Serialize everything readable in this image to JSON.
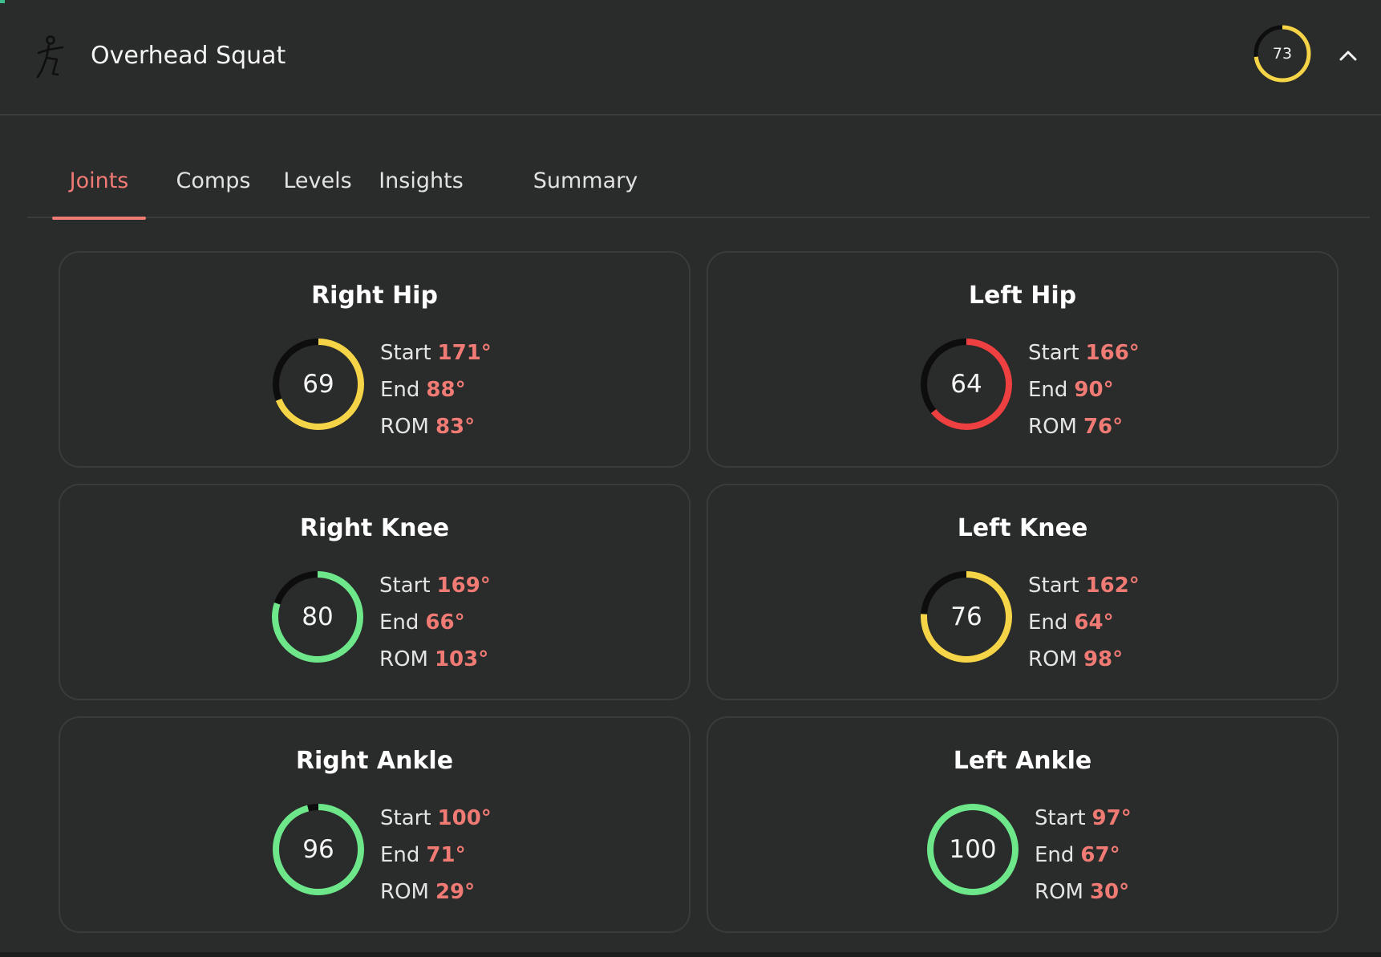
{
  "header": {
    "title": "Overhead Squat",
    "score": "73",
    "score_fraction": 0.73,
    "score_color": "#f5d547",
    "icon": "squat-figure-icon",
    "collapse_icon": "chevron-up-icon"
  },
  "tabs": [
    {
      "label": "Joints",
      "active": true
    },
    {
      "label": "Comps",
      "active": false
    },
    {
      "label": "Levels",
      "active": false
    },
    {
      "label": "Insights",
      "active": false
    },
    {
      "label": "Summary",
      "active": false
    }
  ],
  "stat_labels": {
    "start": "Start",
    "end": "End",
    "rom": "ROM"
  },
  "colors": {
    "accent": "#f07a74",
    "good": "#6ee68a",
    "medium": "#f5d547",
    "poor": "#ee4040",
    "track": "#0d0d0d"
  },
  "joints": [
    {
      "name": "Right Hip",
      "score": "69",
      "score_fraction": 0.69,
      "color": "#f5d547",
      "start": "171°",
      "end": "88°",
      "rom": "83°"
    },
    {
      "name": "Left Hip",
      "score": "64",
      "score_fraction": 0.64,
      "color": "#ee4040",
      "start": "166°",
      "end": "90°",
      "rom": "76°"
    },
    {
      "name": "Right Knee",
      "score": "80",
      "score_fraction": 0.8,
      "color": "#6ee68a",
      "start": "169°",
      "end": "66°",
      "rom": "103°"
    },
    {
      "name": "Left Knee",
      "score": "76",
      "score_fraction": 0.76,
      "color": "#f5d547",
      "start": "162°",
      "end": "64°",
      "rom": "98°"
    },
    {
      "name": "Right Ankle",
      "score": "96",
      "score_fraction": 0.96,
      "color": "#6ee68a",
      "start": "100°",
      "end": "71°",
      "rom": "29°"
    },
    {
      "name": "Left Ankle",
      "score": "100",
      "score_fraction": 1.0,
      "color": "#6ee68a",
      "start": "97°",
      "end": "67°",
      "rom": "30°"
    }
  ]
}
